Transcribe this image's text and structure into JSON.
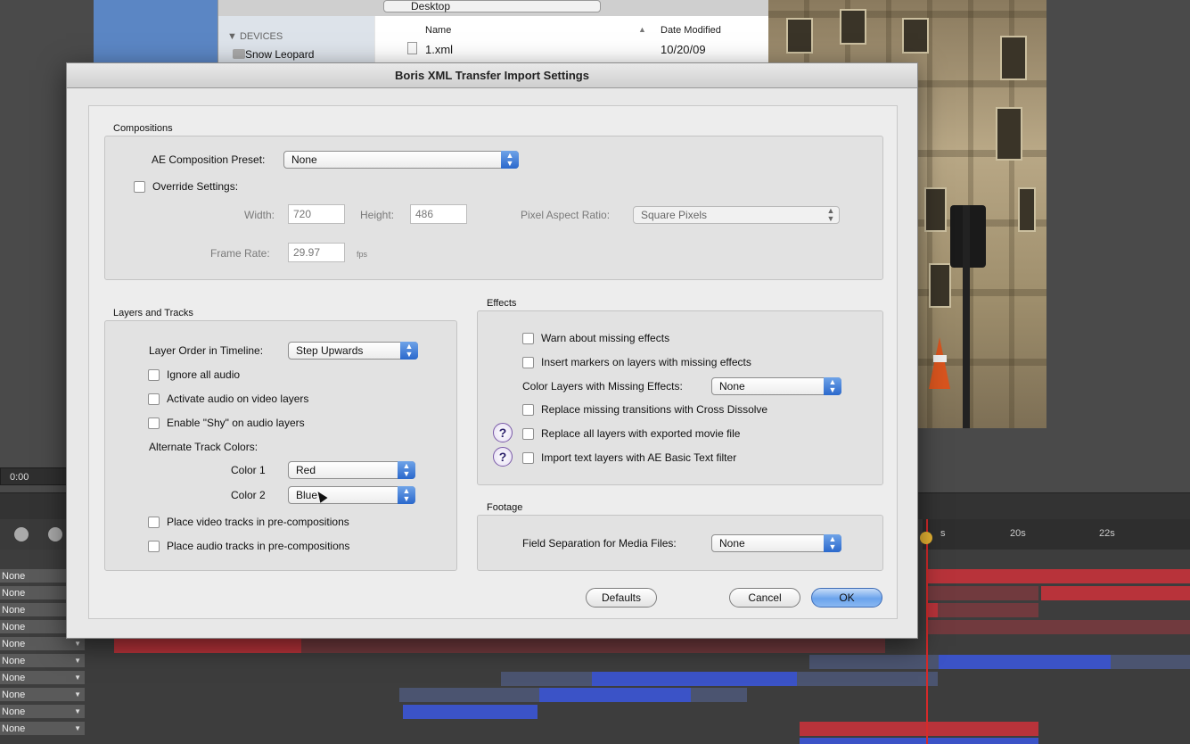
{
  "finder": {
    "location": "Desktop",
    "sidebar_header": "▼ DEVICES",
    "sidebar_item": "Snow Leopard",
    "col_name": "Name",
    "col_date": "Date Modified",
    "file_name": "1.xml",
    "file_date": "10/20/09"
  },
  "timeline": {
    "timecode": "0:00",
    "ruler_marks": [
      "s",
      "20s",
      "22s"
    ],
    "layer_label": "None",
    "layer_count": 10
  },
  "dialog": {
    "title": "Boris XML Transfer Import Settings",
    "compositions": {
      "label": "Compositions",
      "preset_label": "AE Composition Preset:",
      "preset_value": "None",
      "override_label": "Override Settings:",
      "width_label": "Width:",
      "width_value": "720",
      "height_label": "Height:",
      "height_value": "486",
      "par_label": "Pixel Aspect Ratio:",
      "par_value": "Square Pixels",
      "framerate_label": "Frame Rate:",
      "framerate_value": "29.97",
      "fps_label": "fps"
    },
    "layers": {
      "label": "Layers and Tracks",
      "order_label": "Layer Order in Timeline:",
      "order_value": "Step Upwards",
      "ignore_audio": "Ignore all audio",
      "activate_audio": "Activate audio on video layers",
      "enable_shy": "Enable \"Shy\" on audio layers",
      "alt_colors_label": "Alternate Track Colors:",
      "color1_label": "Color 1",
      "color1_value": "Red",
      "color2_label": "Color 2",
      "color2_value": "Blue",
      "place_video": "Place video tracks in pre-compositions",
      "place_audio": "Place audio tracks in pre-compositions"
    },
    "effects": {
      "label": "Effects",
      "warn_missing": "Warn about missing effects",
      "insert_markers": "Insert markers on layers with missing effects",
      "color_layers_label": "Color Layers with Missing Effects:",
      "color_layers_value": "None",
      "replace_transitions": "Replace missing transitions with Cross Dissolve",
      "replace_all": "Replace all layers with exported movie file",
      "import_text": "Import text layers with AE Basic Text filter",
      "help_glyph": "?"
    },
    "footage": {
      "label": "Footage",
      "field_sep_label": "Field Separation for Media Files:",
      "field_sep_value": "None"
    },
    "buttons": {
      "defaults": "Defaults",
      "cancel": "Cancel",
      "ok": "OK"
    }
  },
  "colors": {
    "accent_blue": "#2a68cc",
    "clip_red": "#b8333a",
    "clip_blue": "#3b53c7",
    "playhead": "#d62a2a"
  }
}
